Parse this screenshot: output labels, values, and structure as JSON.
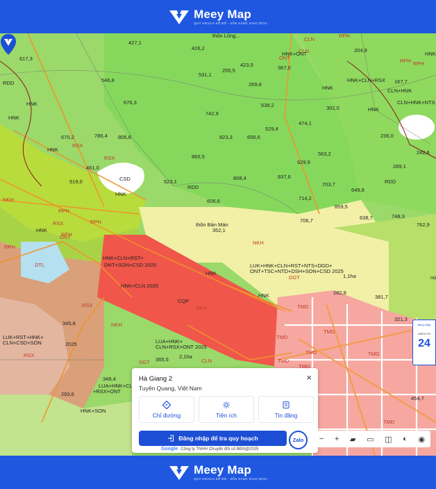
{
  "brand": {
    "name": "Meey Map",
    "tagline": "QUY HOẠCH SỔ ĐỎ - SẴN SÀNG GIAO DỊCH"
  },
  "map_labels": [
    {
      "t": "thôn Lũng..."
    },
    {
      "t": "HNK+ONT"
    },
    {
      "t": "CLN"
    },
    {
      "t": "RPH"
    },
    {
      "t": "204,9"
    },
    {
      "t": "427,1"
    },
    {
      "t": "426,2"
    },
    {
      "t": "617,3"
    },
    {
      "t": "RPH"
    },
    {
      "t": "HNK"
    },
    {
      "t": "RPH"
    },
    {
      "t": "423,5"
    },
    {
      "t": "ONT"
    },
    {
      "t": "367,0"
    },
    {
      "t": "CLN"
    },
    {
      "t": "HNK"
    },
    {
      "t": "531,1"
    },
    {
      "t": "255,5"
    },
    {
      "t": "HNK+CLN+RSX"
    },
    {
      "t": "167,7"
    },
    {
      "t": "RDD"
    },
    {
      "t": "546,8"
    },
    {
      "t": "269,8"
    },
    {
      "t": "CLN+HNK"
    },
    {
      "t": "676,3"
    },
    {
      "t": "538,2"
    },
    {
      "t": "HNK"
    },
    {
      "t": "302,0"
    },
    {
      "t": "CLN+HNK+NTS"
    },
    {
      "t": "HNK"
    },
    {
      "t": "742,9"
    },
    {
      "t": "HNK"
    },
    {
      "t": "474,1"
    },
    {
      "t": "529,4"
    },
    {
      "t": "670,2"
    },
    {
      "t": "786,4"
    },
    {
      "t": "806,8"
    },
    {
      "t": "823,3"
    },
    {
      "t": "656,6"
    },
    {
      "t": "236,0"
    },
    {
      "t": "RSX"
    },
    {
      "t": "HNK"
    },
    {
      "t": "RSX"
    },
    {
      "t": "865,5"
    },
    {
      "t": "563,2"
    },
    {
      "t": "242,6"
    },
    {
      "t": "629,9"
    },
    {
      "t": "289,1"
    },
    {
      "t": "461,0"
    },
    {
      "t": "CSD"
    },
    {
      "t": "519,0"
    },
    {
      "t": "523,1"
    },
    {
      "t": "808,4"
    },
    {
      "t": "837,6"
    },
    {
      "t": "703,7"
    },
    {
      "t": "RDD"
    },
    {
      "t": "RDD"
    },
    {
      "t": "649,8"
    },
    {
      "t": "HNK"
    },
    {
      "t": "714,2"
    },
    {
      "t": "NKH"
    },
    {
      "t": "RPH"
    },
    {
      "t": "606,6"
    },
    {
      "t": "859,5"
    },
    {
      "t": "RPH"
    },
    {
      "t": "RPH"
    },
    {
      "t": "638,7"
    },
    {
      "t": "748,3"
    },
    {
      "t": "706,7"
    },
    {
      "t": "762,9"
    },
    {
      "t": "RSX"
    },
    {
      "t": "thôn Bản Mán"
    },
    {
      "t": "352,1"
    },
    {
      "t": "HNK"
    },
    {
      "t": "RPH"
    },
    {
      "t": "ONT"
    },
    {
      "t": "NKH"
    },
    {
      "t": "DTL"
    },
    {
      "t": "HNK+CLN+RST+"
    },
    {
      "t": "DHT+SON+CSD 2025"
    },
    {
      "t": "HNK"
    },
    {
      "t": "LUK+HNK+CLN+RST+NTS+DGD+"
    },
    {
      "t": "ONT+TSC+NTD+DSH+SON+CSD 2025"
    },
    {
      "t": "DGT"
    },
    {
      "t": "1,1ha"
    },
    {
      "t": "HNK+CLN 2025"
    },
    {
      "t": "CQP"
    },
    {
      "t": "NKH"
    },
    {
      "t": "282,8"
    },
    {
      "t": "381,7"
    },
    {
      "t": "núi Rặng"
    },
    {
      "t": "HNK"
    },
    {
      "t": "RSX"
    },
    {
      "t": "TMD"
    },
    {
      "t": "TMD"
    },
    {
      "t": "321,3"
    },
    {
      "t": "345,8"
    },
    {
      "t": "NKH"
    },
    {
      "t": "LUK+RST+HNK+"
    },
    {
      "t": "CLN+CSD+SON"
    },
    {
      "t": "2025"
    },
    {
      "t": "RSX"
    },
    {
      "t": "TMD"
    },
    {
      "t": "TMD"
    },
    {
      "t": "TMD"
    },
    {
      "t": "LUA+HNK+"
    },
    {
      "t": "CLN+RSX+ONT 2025"
    },
    {
      "t": "DGT"
    },
    {
      "t": "365,5"
    },
    {
      "t": "2,1ha"
    },
    {
      "t": "CLN"
    },
    {
      "t": "TMD"
    },
    {
      "t": "TMD"
    },
    {
      "t": "348,4"
    },
    {
      "t": "LUA+HNK+CLN"
    },
    {
      "t": "+RSX+ONT"
    },
    {
      "t": "293,6"
    },
    {
      "t": "HNK+SON"
    },
    {
      "t": "454,7"
    },
    {
      "t": "TMD"
    }
  ],
  "popup": {
    "place": "Hà Giang 2",
    "region": "Tuyên Quang, Việt Nam",
    "close": "×",
    "actions": [
      {
        "label": "Chỉ đường",
        "icon": "directions-icon"
      },
      {
        "label": "Tiện ích",
        "icon": "amenities-icon"
      },
      {
        "label": "Tin đăng",
        "icon": "listing-icon"
      }
    ],
    "login_label": "Đăng nhập để tra quy hoạch"
  },
  "zalo": "Zalo",
  "credit": {
    "google": "Google",
    "text": "Công ty TNHH Chuyển đổi số BĐS@2025"
  },
  "tools": [
    "−",
    "+"
  ],
  "side_ad": {
    "line1": "Meey Map",
    "line2": "MIỄN PHÍ",
    "num": "24"
  }
}
